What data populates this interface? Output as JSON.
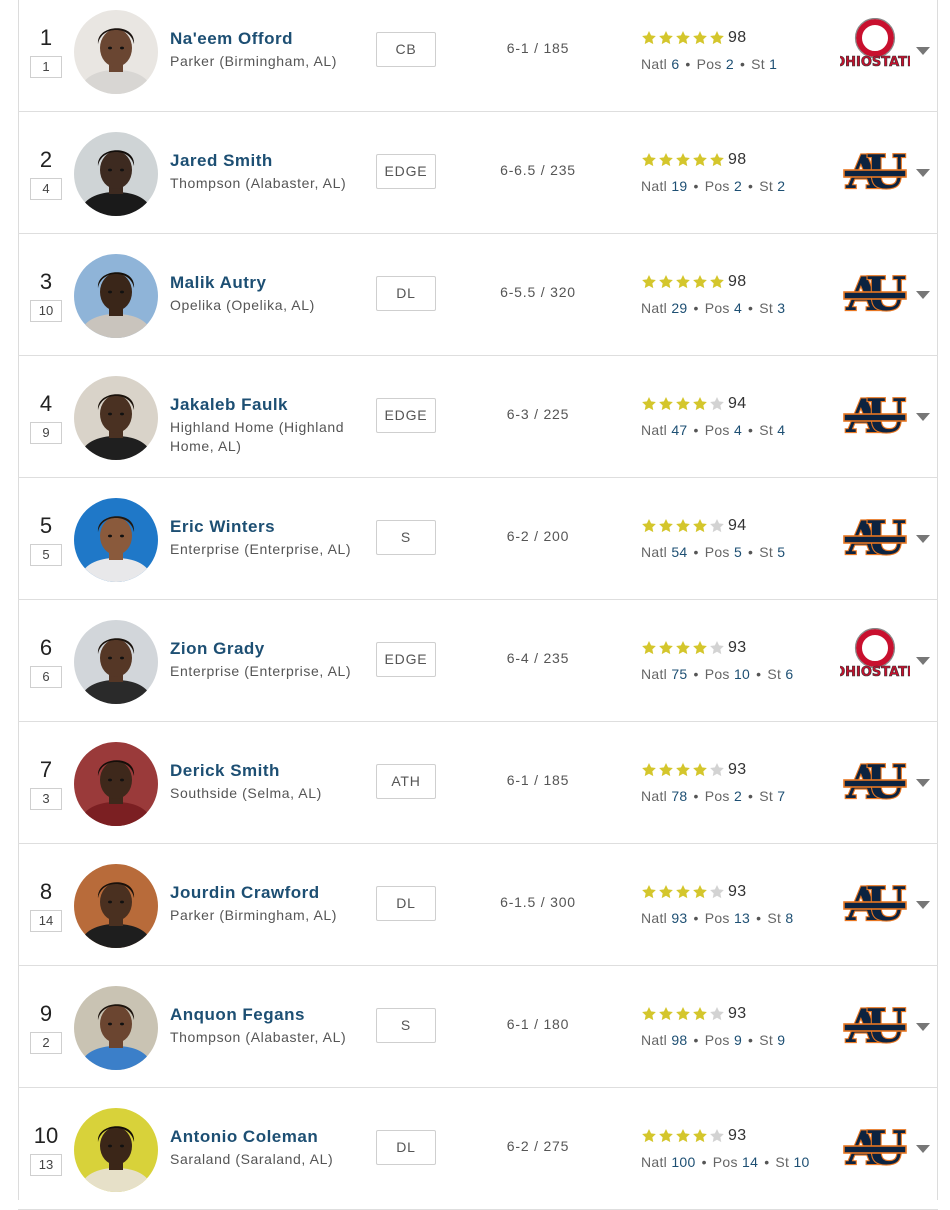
{
  "colors": {
    "link": "#1d4f73",
    "star": "#d4c62c",
    "star_empty": "#d3d3d3",
    "auburn_navy": "#0c2340",
    "auburn_orange": "#e87722",
    "ohio_red": "#c8102e"
  },
  "players": [
    {
      "rank": "1",
      "prev": "1",
      "name": "Na'eem Offord",
      "school": "Parker (Birmingham, AL)",
      "pos": "CB",
      "htwt": "6-1 / 185",
      "stars": 5,
      "rating": "98",
      "natl": "6",
      "posrank": "2",
      "strank": "1",
      "logo": "ohio-state",
      "photo_bg": "#e9e6e2",
      "skin": "#6a4632",
      "hair": "#1c1410",
      "shirt": "#d8d6d3"
    },
    {
      "rank": "2",
      "prev": "4",
      "name": "Jared Smith",
      "school": "Thompson (Alabaster, AL)",
      "pos": "EDGE",
      "htwt": "6-6.5 / 235",
      "stars": 5,
      "rating": "98",
      "natl": "19",
      "posrank": "2",
      "strank": "2",
      "logo": "auburn",
      "photo_bg": "#cfd4d6",
      "skin": "#3d2a20",
      "hair": "#120d0a",
      "shirt": "#1a1a1a"
    },
    {
      "rank": "3",
      "prev": "10",
      "name": "Malik Autry",
      "school": "Opelika (Opelika, AL)",
      "pos": "DL",
      "htwt": "6-5.5 / 320",
      "stars": 5,
      "rating": "98",
      "natl": "29",
      "posrank": "4",
      "strank": "3",
      "logo": "auburn",
      "photo_bg": "#8fb4d8",
      "skin": "#3a2619",
      "hair": "#171008",
      "shirt": "#c9c4bd"
    },
    {
      "rank": "4",
      "prev": "9",
      "name": "Jakaleb Faulk",
      "school": "Highland Home (Highland Home, AL)",
      "pos": "EDGE",
      "htwt": "6-3 / 225",
      "stars": 4,
      "rating": "94",
      "natl": "47",
      "posrank": "4",
      "strank": "4",
      "logo": "auburn",
      "photo_bg": "#d9d3c9",
      "skin": "#4a3122",
      "hair": "#1a120c",
      "shirt": "#1f1f1f"
    },
    {
      "rank": "5",
      "prev": "5",
      "name": "Eric Winters",
      "school": "Enterprise (Enterprise, AL)",
      "pos": "S",
      "htwt": "6-2 / 200",
      "stars": 4,
      "rating": "94",
      "natl": "54",
      "posrank": "5",
      "strank": "5",
      "logo": "auburn",
      "photo_bg": "#1f78c8",
      "skin": "#8a5a3c",
      "hair": "#221810",
      "shirt": "#e8e8ea"
    },
    {
      "rank": "6",
      "prev": "6",
      "name": "Zion Grady",
      "school": "Enterprise (Enterprise, AL)",
      "pos": "EDGE",
      "htwt": "6-4 / 235",
      "stars": 4,
      "rating": "93",
      "natl": "75",
      "posrank": "10",
      "strank": "6",
      "logo": "ohio-state",
      "photo_bg": "#d2d6da",
      "skin": "#553726",
      "hair": "#1b130d",
      "shirt": "#2a2a2a"
    },
    {
      "rank": "7",
      "prev": "3",
      "name": "Derick Smith",
      "school": "Southside (Selma, AL)",
      "pos": "ATH",
      "htwt": "6-1 / 185",
      "stars": 4,
      "rating": "93",
      "natl": "78",
      "posrank": "2",
      "strank": "7",
      "logo": "auburn",
      "photo_bg": "#9a3a3a",
      "skin": "#3e281b",
      "hair": "#140e09",
      "shirt": "#7b1f22"
    },
    {
      "rank": "8",
      "prev": "14",
      "name": "Jourdin Crawford",
      "school": "Parker (Birmingham, AL)",
      "pos": "DL",
      "htwt": "6-1.5 / 300",
      "stars": 4,
      "rating": "93",
      "natl": "93",
      "posrank": "13",
      "strank": "8",
      "logo": "auburn",
      "photo_bg": "#b86b3a",
      "skin": "#4a3020",
      "hair": "#1a110b",
      "shirt": "#1e1e1e"
    },
    {
      "rank": "9",
      "prev": "2",
      "name": "Anquon Fegans",
      "school": "Thompson (Alabaster, AL)",
      "pos": "S",
      "htwt": "6-1 / 180",
      "stars": 4,
      "rating": "93",
      "natl": "98",
      "posrank": "9",
      "strank": "9",
      "logo": "auburn",
      "photo_bg": "#c9c3b3",
      "skin": "#6b4530",
      "hair": "#1d140d",
      "shirt": "#3b7fc9"
    },
    {
      "rank": "10",
      "prev": "13",
      "name": "Antonio Coleman",
      "school": "Saraland (Saraland, AL)",
      "pos": "DL",
      "htwt": "6-2 / 275",
      "stars": 4,
      "rating": "93",
      "natl": "100",
      "posrank": "14",
      "strank": "10",
      "logo": "auburn",
      "photo_bg": "#d8d23a",
      "skin": "#3b2618",
      "hair": "#130d08",
      "shirt": "#e6e0c8"
    }
  ],
  "labels": {
    "natl": "Natl",
    "pos": "Pos",
    "st": "St",
    "dot": "•",
    "ohio_line1": "OHIO",
    "ohio_line2": "STATE",
    "auburn_a": "A",
    "auburn_u": "U"
  }
}
